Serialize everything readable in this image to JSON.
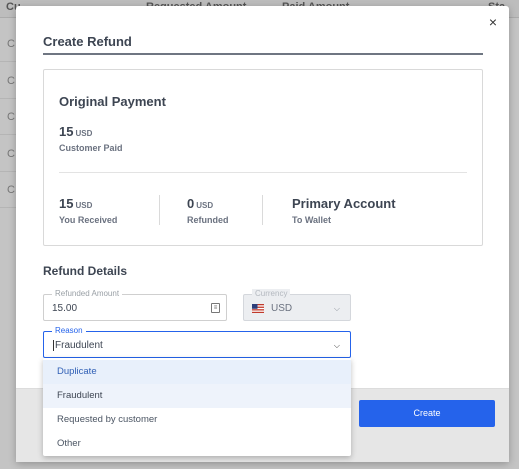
{
  "background": {
    "header_cells": [
      "Cu",
      "Requested Amount",
      "Paid Amount",
      "Sta"
    ],
    "row_letters": [
      "C",
      "C",
      "C",
      "C",
      "C"
    ]
  },
  "modal": {
    "title": "Create Refund",
    "close_label": "×",
    "original_payment": {
      "heading": "Original Payment",
      "paid_amount": "15",
      "paid_currency": "USD",
      "paid_label": "Customer Paid",
      "received_amount": "15",
      "received_currency": "USD",
      "received_label": "You Received",
      "refunded_amount": "0",
      "refunded_currency": "USD",
      "refunded_label": "Refunded",
      "account_name": "Primary Account",
      "account_label": "To Wallet"
    },
    "refund_details": {
      "heading": "Refund Details",
      "amount_label": "Refunded Amount",
      "amount_value": "15.00",
      "currency_label": "Currency",
      "currency_value": "USD",
      "reason_label": "Reason",
      "reason_value": "Fraudulent",
      "reason_options": [
        "Duplicate",
        "Fraudulent",
        "Requested by customer",
        "Other"
      ]
    },
    "create_button": "Create"
  },
  "colors": {
    "accent": "#2563eb",
    "text": "#3d4552",
    "muted": "#6b7280"
  }
}
